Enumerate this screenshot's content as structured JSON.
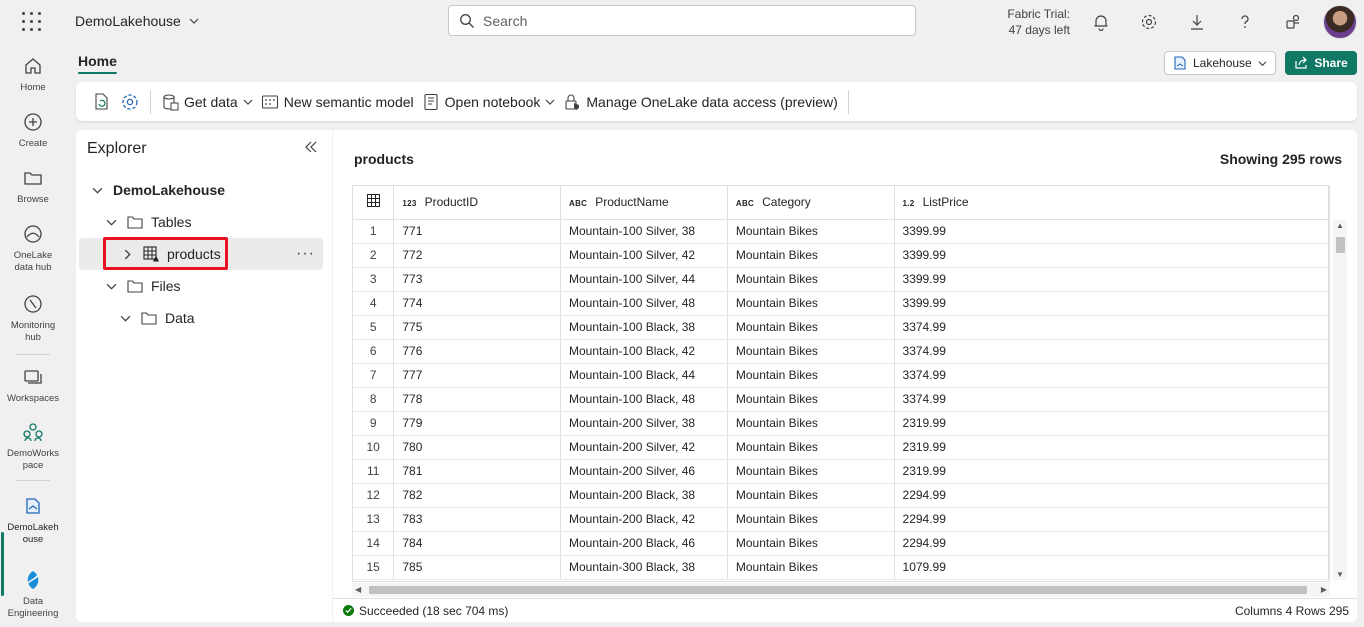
{
  "app": {
    "workspace_item": "DemoLakehouse",
    "search_placeholder": "Search",
    "trial_line1": "Fabric Trial:",
    "trial_line2": "47 days left"
  },
  "rail": [
    {
      "label": "Home",
      "icon": "home-icon"
    },
    {
      "label": "Create",
      "icon": "create-icon"
    },
    {
      "label": "Browse",
      "icon": "browse-icon"
    },
    {
      "label": "OneLake data hub",
      "icon": "onelake-icon"
    },
    {
      "label": "Monitoring hub",
      "icon": "monitoring-icon"
    },
    {
      "label": "Workspaces",
      "icon": "workspaces-icon"
    },
    {
      "label": "DemoWorkspace",
      "icon": "workspace-icon"
    },
    {
      "label": "DemoLakehouse",
      "icon": "lakehouse-icon"
    },
    {
      "label": "Data Engineering",
      "icon": "data-engineering-icon"
    }
  ],
  "header": {
    "tab": "Home",
    "view_selector": "Lakehouse",
    "share": "Share"
  },
  "toolbar": {
    "get_data": "Get data",
    "new_semantic_model": "New semantic model",
    "open_notebook": "Open notebook",
    "manage_access": "Manage OneLake data access (preview)"
  },
  "explorer": {
    "title": "Explorer",
    "root": "DemoLakehouse",
    "tables": "Tables",
    "products": "products",
    "files": "Files",
    "data": "Data"
  },
  "data_panel": {
    "table_name": "products",
    "showing": "Showing 295 rows",
    "columns": [
      {
        "type": "123",
        "name": "ProductID"
      },
      {
        "type": "ABC",
        "name": "ProductName"
      },
      {
        "type": "ABC",
        "name": "Category"
      },
      {
        "type": "1.2",
        "name": "ListPrice"
      }
    ],
    "rows": [
      [
        "1",
        "771",
        "Mountain-100 Silver, 38",
        "Mountain Bikes",
        "3399.99"
      ],
      [
        "2",
        "772",
        "Mountain-100 Silver, 42",
        "Mountain Bikes",
        "3399.99"
      ],
      [
        "3",
        "773",
        "Mountain-100 Silver, 44",
        "Mountain Bikes",
        "3399.99"
      ],
      [
        "4",
        "774",
        "Mountain-100 Silver, 48",
        "Mountain Bikes",
        "3399.99"
      ],
      [
        "5",
        "775",
        "Mountain-100 Black, 38",
        "Mountain Bikes",
        "3374.99"
      ],
      [
        "6",
        "776",
        "Mountain-100 Black, 42",
        "Mountain Bikes",
        "3374.99"
      ],
      [
        "7",
        "777",
        "Mountain-100 Black, 44",
        "Mountain Bikes",
        "3374.99"
      ],
      [
        "8",
        "778",
        "Mountain-100 Black, 48",
        "Mountain Bikes",
        "3374.99"
      ],
      [
        "9",
        "779",
        "Mountain-200 Silver, 38",
        "Mountain Bikes",
        "2319.99"
      ],
      [
        "10",
        "780",
        "Mountain-200 Silver, 42",
        "Mountain Bikes",
        "2319.99"
      ],
      [
        "11",
        "781",
        "Mountain-200 Silver, 46",
        "Mountain Bikes",
        "2319.99"
      ],
      [
        "12",
        "782",
        "Mountain-200 Black, 38",
        "Mountain Bikes",
        "2294.99"
      ],
      [
        "13",
        "783",
        "Mountain-200 Black, 42",
        "Mountain Bikes",
        "2294.99"
      ],
      [
        "14",
        "784",
        "Mountain-200 Black, 46",
        "Mountain Bikes",
        "2294.99"
      ],
      [
        "15",
        "785",
        "Mountain-300 Black, 38",
        "Mountain Bikes",
        "1079.99"
      ]
    ],
    "status": "Succeeded (18 sec 704 ms)",
    "summary": "Columns 4 Rows 295"
  },
  "colors": {
    "accent": "#117865",
    "highlight": "#e81123",
    "success": "#0e7a0d"
  }
}
